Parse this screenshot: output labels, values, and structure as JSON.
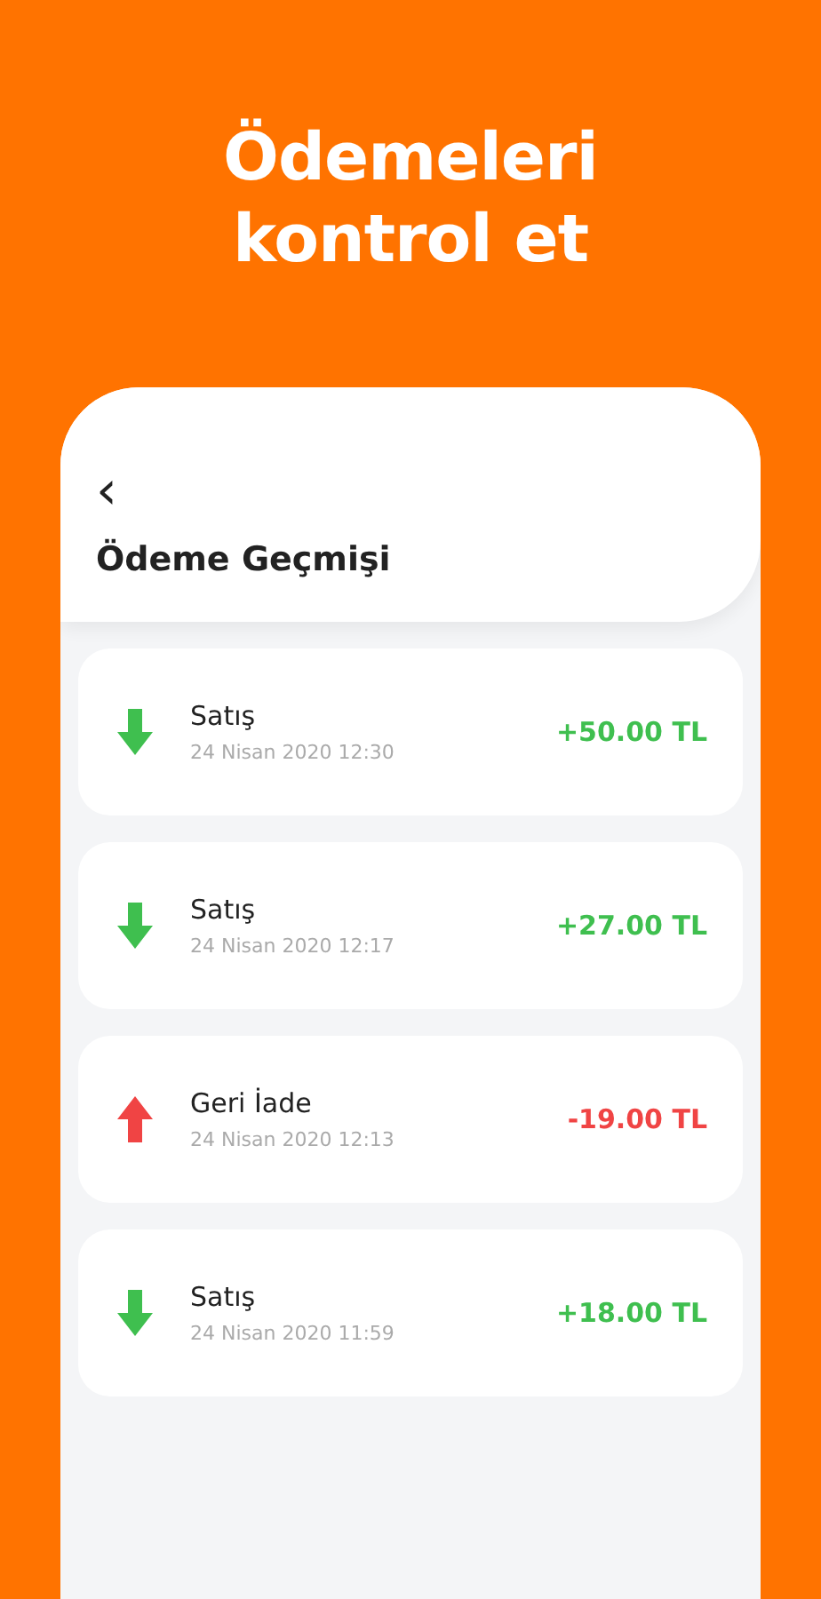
{
  "headline": "Ödemeleri kontrol et",
  "screen": {
    "back_icon": "‹",
    "title": "Ödeme Geçmişi"
  },
  "transactions": [
    {
      "kind": "incoming",
      "label": "Satış",
      "date": "24 Nisan 2020 12:30",
      "amount": "+50.00 TL"
    },
    {
      "kind": "incoming",
      "label": "Satış",
      "date": "24 Nisan 2020 12:17",
      "amount": "+27.00 TL"
    },
    {
      "kind": "refund",
      "label": "Geri İade",
      "date": "24 Nisan 2020 12:13",
      "amount": "-19.00 TL"
    },
    {
      "kind": "incoming",
      "label": "Satış",
      "date": "24 Nisan 2020 11:59",
      "amount": "+18.00 TL"
    }
  ]
}
